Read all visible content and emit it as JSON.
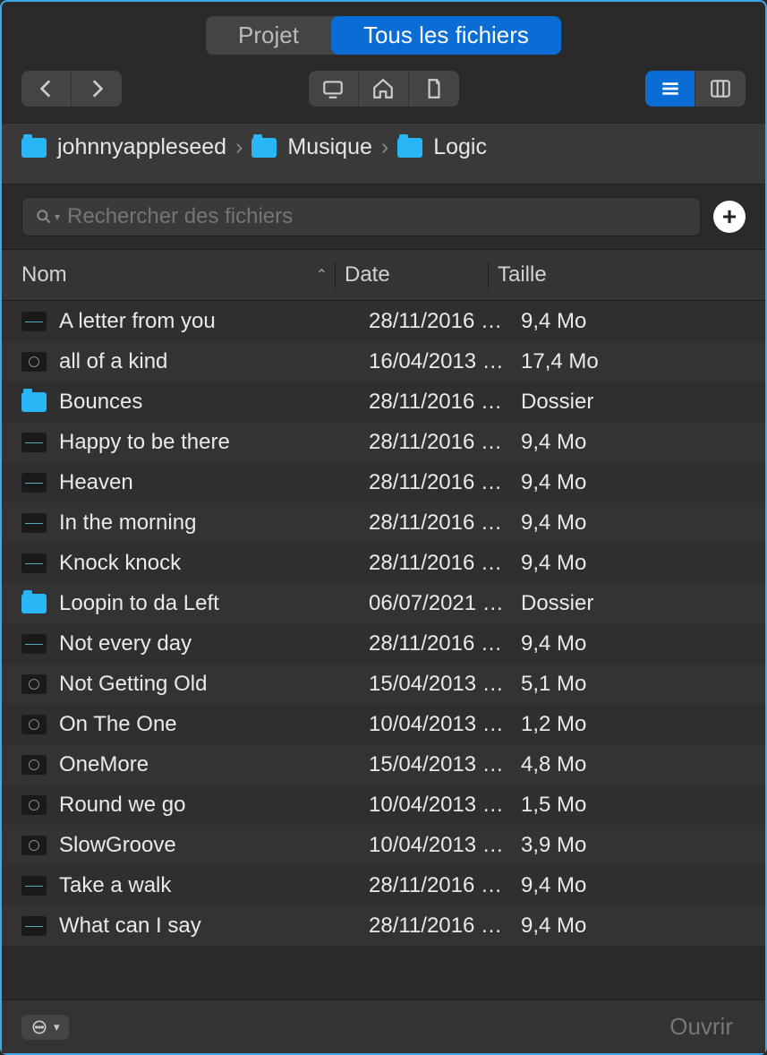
{
  "tabs": {
    "project": "Projet",
    "all_files": "Tous les fichiers",
    "active": "all_files"
  },
  "breadcrumb": {
    "items": [
      {
        "label": "johnnyappleseed",
        "icon": "user-folder"
      },
      {
        "label": "Musique",
        "icon": "music-folder"
      },
      {
        "label": "Logic",
        "icon": "folder"
      }
    ],
    "separator": "›"
  },
  "search": {
    "placeholder": "Rechercher des fichiers"
  },
  "columns": {
    "name": "Nom",
    "date": "Date",
    "size": "Taille"
  },
  "files": [
    {
      "name": "A letter from you",
      "date": "28/11/2016 …",
      "size": "9,4 Mo",
      "kind": "audio"
    },
    {
      "name": "all of a kind",
      "date": "16/04/2013 …",
      "size": "17,4 Mo",
      "kind": "project"
    },
    {
      "name": "Bounces",
      "date": "28/11/2016 …",
      "size": "Dossier",
      "kind": "folder"
    },
    {
      "name": "Happy to be there",
      "date": "28/11/2016 …",
      "size": "9,4 Mo",
      "kind": "audio"
    },
    {
      "name": "Heaven",
      "date": "28/11/2016 …",
      "size": "9,4 Mo",
      "kind": "audio"
    },
    {
      "name": "In the morning",
      "date": "28/11/2016 …",
      "size": "9,4 Mo",
      "kind": "audio"
    },
    {
      "name": "Knock knock",
      "date": "28/11/2016 …",
      "size": "9,4 Mo",
      "kind": "audio"
    },
    {
      "name": "Loopin to da Left",
      "date": "06/07/2021 …",
      "size": "Dossier",
      "kind": "folder"
    },
    {
      "name": "Not every day",
      "date": "28/11/2016 …",
      "size": "9,4 Mo",
      "kind": "audio"
    },
    {
      "name": "Not Getting Old",
      "date": "15/04/2013 …",
      "size": "5,1 Mo",
      "kind": "project"
    },
    {
      "name": "On The One",
      "date": "10/04/2013 …",
      "size": "1,2 Mo",
      "kind": "project"
    },
    {
      "name": "OneMore",
      "date": "15/04/2013 …",
      "size": "4,8 Mo",
      "kind": "project"
    },
    {
      "name": "Round we go",
      "date": "10/04/2013 …",
      "size": "1,5 Mo",
      "kind": "project"
    },
    {
      "name": "SlowGroove",
      "date": "10/04/2013 …",
      "size": "3,9 Mo",
      "kind": "project"
    },
    {
      "name": "Take a walk",
      "date": "28/11/2016 …",
      "size": "9,4 Mo",
      "kind": "audio"
    },
    {
      "name": "What can I say",
      "date": "28/11/2016 …",
      "size": "9,4 Mo",
      "kind": "audio"
    }
  ],
  "footer": {
    "open": "Ouvrir"
  }
}
